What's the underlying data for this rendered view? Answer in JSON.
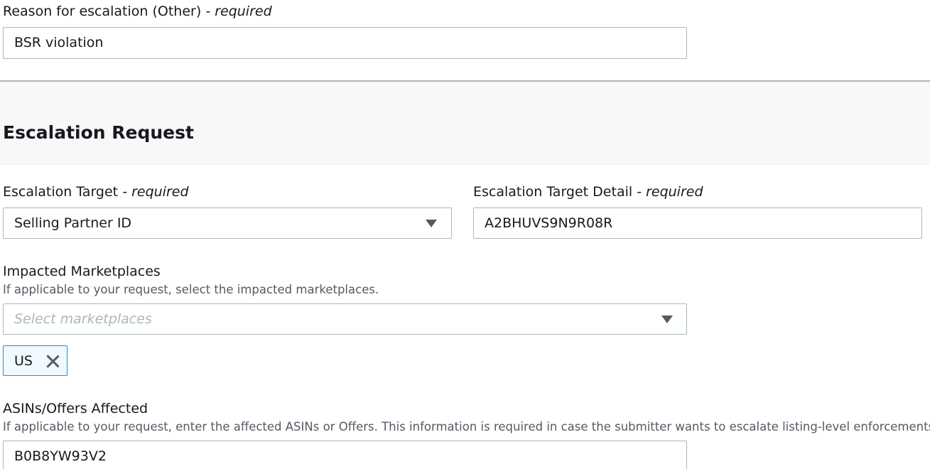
{
  "reason_field": {
    "label": "Reason for escalation (Other)",
    "required_suffix": "- required",
    "value": "BSR violation"
  },
  "section": {
    "title": "Escalation Request"
  },
  "escalation_target": {
    "label": "Escalation Target",
    "required_suffix": "- required",
    "selected": "Selling Partner ID"
  },
  "escalation_target_detail": {
    "label": "Escalation Target Detail",
    "required_suffix": "- required",
    "value": "A2BHUVS9N9R08R"
  },
  "impacted_marketplaces": {
    "label": "Impacted Marketplaces",
    "description": "If applicable to your request, select the impacted marketplaces.",
    "placeholder": "Select marketplaces",
    "tokens": [
      "US"
    ]
  },
  "asins_offers": {
    "label": "ASINs/Offers Affected",
    "description": "If applicable to your request, enter the affected ASINs or Offers. This information is required in case the submitter wants to escalate listing-level enforcements.",
    "value": "B0B8YW93V2"
  },
  "icons": {
    "dropdown": "caret-down-icon",
    "remove_token": "close-icon"
  },
  "colors": {
    "border": "#aab7b8",
    "token_border": "#00a1c9",
    "token_bg": "#f1faff",
    "text": "#16191f",
    "muted": "#545b64"
  }
}
